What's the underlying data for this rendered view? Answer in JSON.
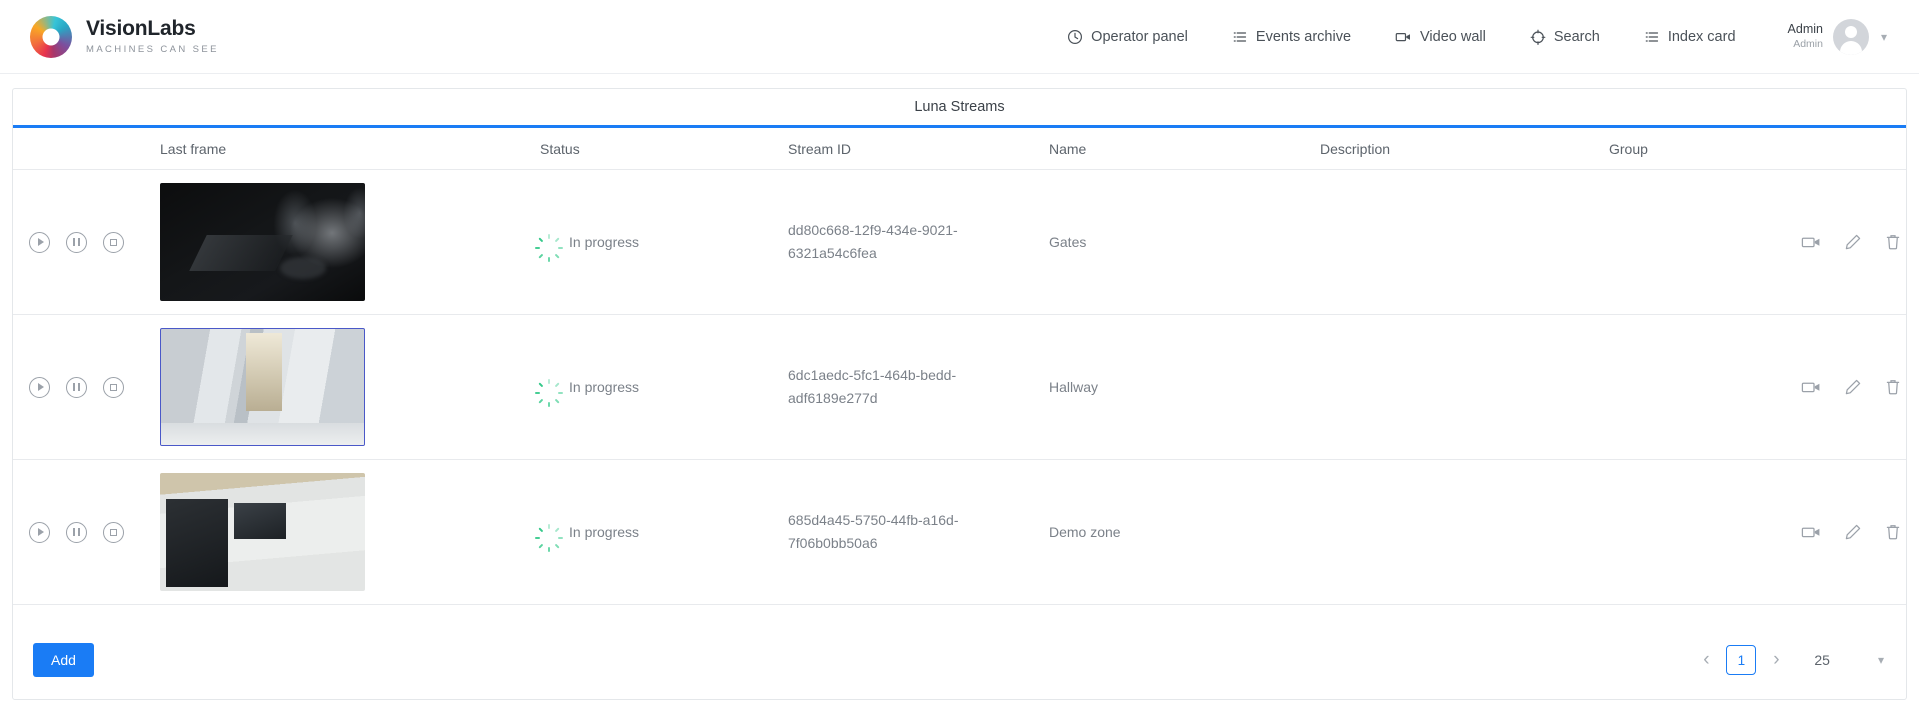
{
  "brand": {
    "name": "VisionLabs",
    "tagline": "MACHINES CAN SEE",
    "logo_icon": "visionlabs-ring-logo"
  },
  "nav": {
    "items": [
      {
        "label": "Operator panel",
        "icon": "clock-icon"
      },
      {
        "label": "Events archive",
        "icon": "list-icon"
      },
      {
        "label": "Video wall",
        "icon": "video-camera-icon"
      },
      {
        "label": "Search",
        "icon": "target-icon"
      },
      {
        "label": "Index card",
        "icon": "list-icon"
      }
    ]
  },
  "user": {
    "primary": "Admin",
    "secondary": "Admin",
    "avatar_icon": "user-avatar-icon",
    "caret_icon": "chevron-down-icon"
  },
  "panel": {
    "title": "Luna Streams",
    "accent_color": "#1a7cf5"
  },
  "table": {
    "headers": {
      "last_frame": "Last frame",
      "status": "Status",
      "stream_id": "Stream ID",
      "name": "Name",
      "description": "Description",
      "group": "Group"
    },
    "rows": [
      {
        "status": "In progress",
        "stream_id": "dd80c668-12f9-434e-9021-6321a54c6fea",
        "name": "Gates",
        "description": "",
        "group": "",
        "thumbnail": "night-vision-gate-scene"
      },
      {
        "status": "In progress",
        "stream_id": "6dc1aedc-5fc1-464b-bedd-adf6189e277d",
        "name": "Hallway",
        "description": "",
        "group": "",
        "thumbnail": "office-hallway-scene"
      },
      {
        "status": "In progress",
        "stream_id": "685d4a45-5750-44fb-a16d-7f06b0bb50a6",
        "name": "Demo zone",
        "description": "",
        "group": "",
        "thumbnail": "demo-lab-room-scene"
      }
    ],
    "row_controls": {
      "play": "play-icon",
      "pause": "pause-icon",
      "stop": "stop-icon"
    },
    "row_actions": {
      "video": "video-camera-icon",
      "edit": "pencil-icon",
      "delete": "trash-icon"
    },
    "status_icon": "loading-spinner-icon",
    "status_color": "#35c98a"
  },
  "footer": {
    "add_label": "Add",
    "add_color": "#1a7cf5",
    "pagination": {
      "prev_icon": "chevron-left-icon",
      "next_icon": "chevron-right-icon",
      "current_page": "1",
      "page_size": "25",
      "page_size_caret": "chevron-down-icon"
    }
  }
}
